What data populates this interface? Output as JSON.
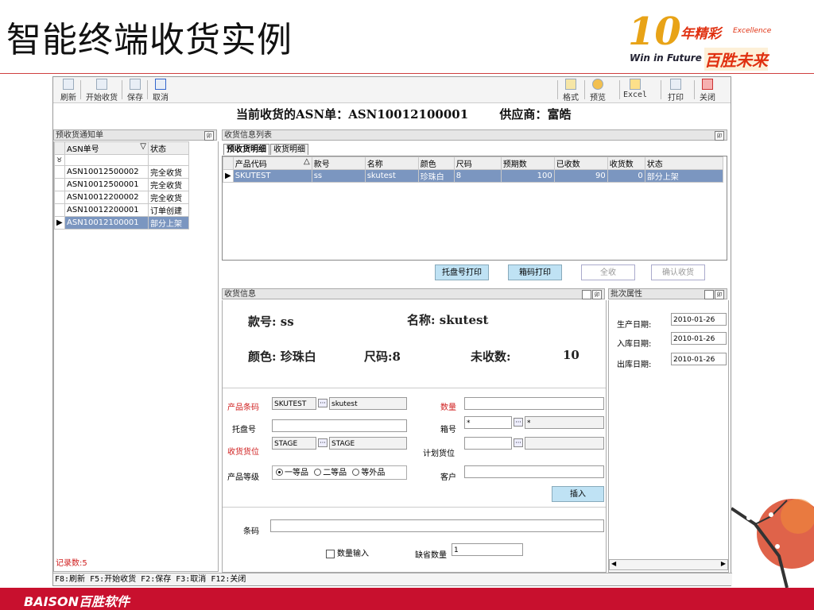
{
  "slide": {
    "title": "智能终端收货实例",
    "logo": {
      "ten": "10",
      "slogan_cn": "年精彩",
      "slogan_en": "Excellence",
      "tagline": "Win in Future",
      "future_cn": "百胜未来"
    },
    "brand": "BAISON百胜软件"
  },
  "toolbar": {
    "refresh": "刷新",
    "start_receive": "开始收货",
    "save": "保存",
    "cancel": "取消",
    "format": "格式",
    "preview": "预览",
    "excel": "Excel",
    "print": "打印",
    "close": "关闭"
  },
  "header": {
    "asn_label": "当前收货的ASN单：",
    "asn_value": "ASN10012100001",
    "supplier_label": "供应商：",
    "supplier_value": "富皓"
  },
  "left_panel": {
    "title": "预收货通知单",
    "columns": [
      "ASN单号",
      "状态"
    ],
    "rows": [
      {
        "asn": "ASN10012500002",
        "status": "完全收货"
      },
      {
        "asn": "ASN10012500001",
        "status": "完全收货"
      },
      {
        "asn": "ASN10012200002",
        "status": "完全收货"
      },
      {
        "asn": "ASN10012200001",
        "status": "订单创建"
      },
      {
        "asn": "ASN10012100001",
        "status": "部分上架"
      }
    ],
    "record_count": "记录数:5"
  },
  "info_list": {
    "title": "收货信息列表",
    "tabs": [
      "预收货明细",
      "收货明细"
    ],
    "columns": [
      "产品代码",
      "款号",
      "名称",
      "颜色",
      "尺码",
      "预期数",
      "已收数",
      "收货数",
      "状态"
    ],
    "rows": [
      {
        "code": "SKUTEST",
        "style": "ss",
        "name": "skutest",
        "color": "珍珠白",
        "size": "8",
        "expected": "100",
        "received": "90",
        "receiving": "0",
        "status": "部分上架"
      }
    ],
    "buttons": {
      "pallet_print": "托盘号打印",
      "box_print": "箱码打印",
      "all": "全收",
      "confirm": "确认收货"
    }
  },
  "receive_info": {
    "title": "收货信息",
    "style_label": "款号:",
    "style_value": "ss",
    "name_label": "名称:",
    "name_value": "skutest",
    "color_label": "颜色:",
    "color_value": "珍珠白",
    "size_label": "尺码:",
    "size_value": "8",
    "unreceived_label": "未收数:",
    "unreceived_value": "10",
    "form": {
      "barcode_label": "产品条码",
      "barcode_value": "SKUTEST",
      "barcode_name": "skutest",
      "qty_label": "数量",
      "qty_value": "",
      "pallet_label": "托盘号",
      "pallet_value": "",
      "box_label": "箱号",
      "box_value": "*",
      "box_value2": "*",
      "location_label": "收货货位",
      "location_value": "STAGE",
      "location_name": "STAGE",
      "plan_location_label": "计划货位",
      "plan_location_value": "",
      "grade_label": "产品等级",
      "grades": [
        "一等品",
        "二等品",
        "等外品"
      ],
      "customer_label": "客户",
      "customer_value": "",
      "insert": "插入",
      "code_label": "条码",
      "code_value": "",
      "qty_input_label": "数量输入",
      "default_qty_label": "缺省数量",
      "default_qty_value": "1"
    }
  },
  "batch": {
    "title": "批次属性",
    "production_date_label": "生产日期:",
    "production_date": "2010-01-26",
    "inbound_date_label": "入库日期:",
    "inbound_date": "2010-01-26",
    "outbound_date_label": "出库日期:",
    "outbound_date": "2010-01-26"
  },
  "statusbar": "F8:刷新  F5:开始收货  F2:保存  F3:取消  F12:关闭",
  "colors": {
    "accent_red": "#c8102e",
    "selection": "#7b96c0",
    "button_blue": "#bfe2f4"
  }
}
